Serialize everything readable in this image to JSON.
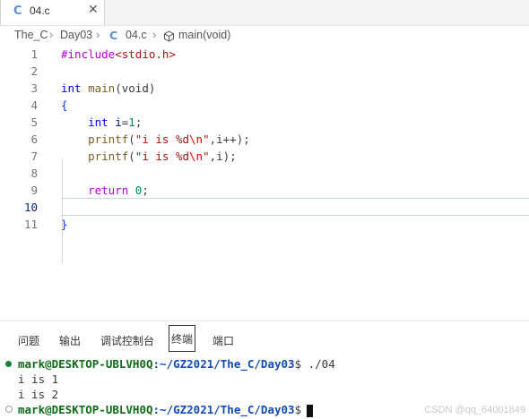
{
  "tab": {
    "icon": "C",
    "label": "04.c",
    "close": "✕"
  },
  "breadcrumb": [
    "The_C",
    "Day03",
    "04.c",
    "main(void)"
  ],
  "editor": {
    "active_line": 10,
    "lines": [
      {
        "n": "1"
      },
      {
        "n": "2"
      },
      {
        "n": "3"
      },
      {
        "n": "4"
      },
      {
        "n": "5"
      },
      {
        "n": "6"
      },
      {
        "n": "7"
      },
      {
        "n": "8"
      },
      {
        "n": "9"
      },
      {
        "n": "10"
      },
      {
        "n": "11"
      }
    ],
    "code": {
      "l1_directive": "#include",
      "l1_header": "<stdio.h>",
      "l3_type": "int",
      "l3_fn": "main",
      "l3_rest": "(void)",
      "l4": "{",
      "l5_type": "int",
      "l5_var": "i",
      "l5_eq": "=",
      "l5_num": "1",
      "l5_end": ";",
      "l6_fn": "printf",
      "l6_open": "(",
      "l6_str1": "\"i is %d",
      "l6_esc": "\\n",
      "l6_str2": "\"",
      "l6_args": ",i++);",
      "l7_fn": "printf",
      "l7_open": "(",
      "l7_str1": "\"i is %d",
      "l7_esc": "\\n",
      "l7_str2": "\"",
      "l7_args": ",i);",
      "l9_kw": "return",
      "l9_num": "0",
      "l9_end": ";",
      "l11": "}"
    }
  },
  "panel": {
    "tabs": [
      "问题",
      "输出",
      "调试控制台",
      "终端",
      "端口"
    ],
    "active_tab": "终端"
  },
  "terminal": {
    "prompt_user": "mark@DESKTOP-UBLVH0Q",
    "prompt_path": ":~/GZ2021/The_C/Day03",
    "prompt_symbol": "$",
    "command": "./04",
    "output1": "i is 1",
    "output2": "i is 2"
  },
  "watermark": "CSDN @qq_64001849"
}
